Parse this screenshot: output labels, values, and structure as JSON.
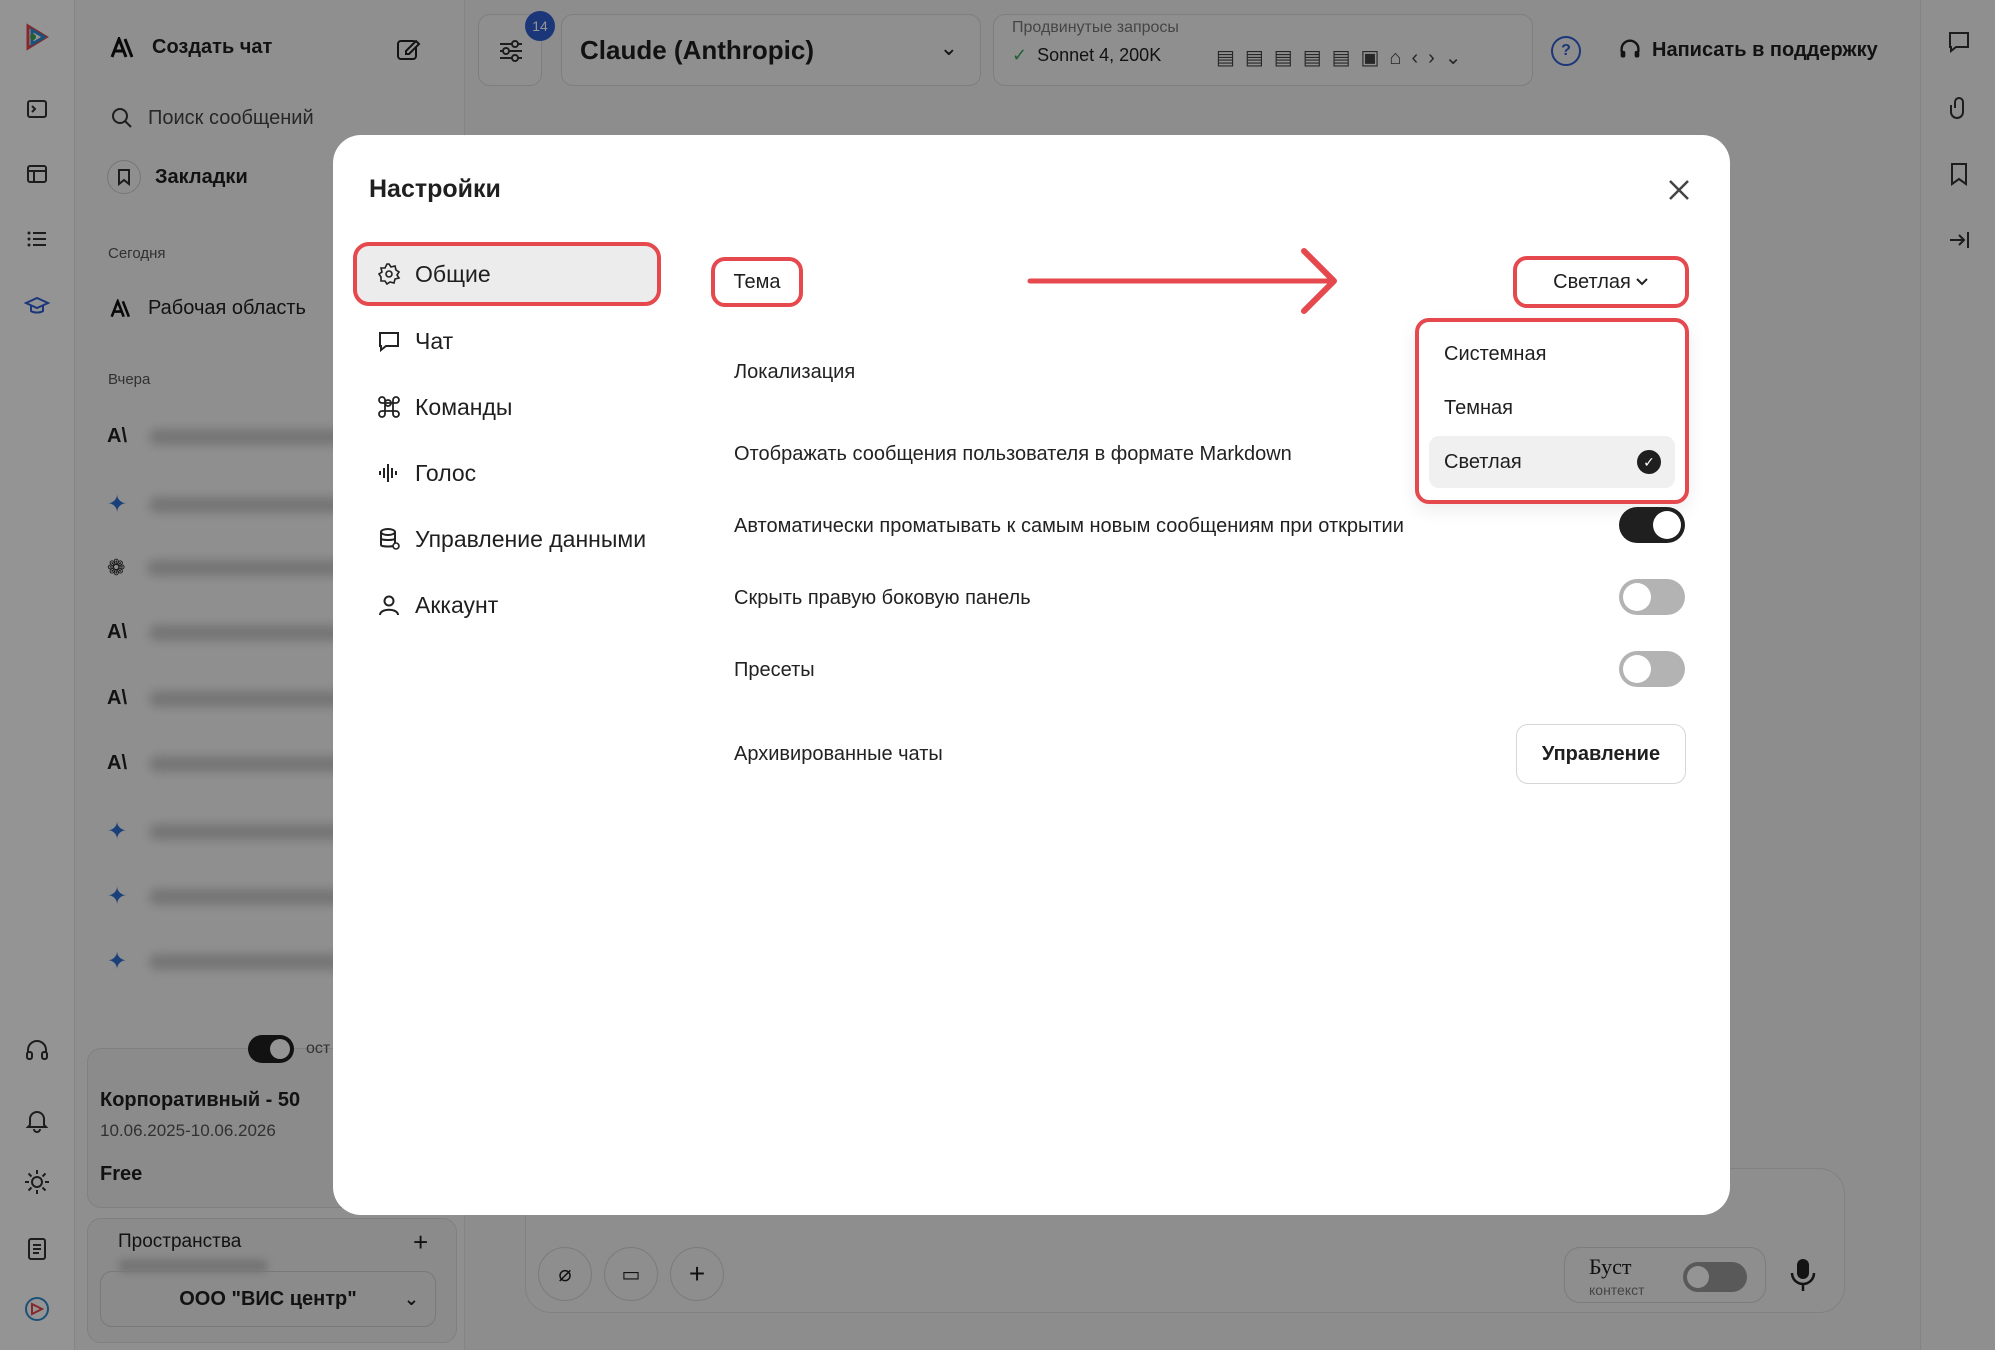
{
  "sidebar": {
    "create_chat": "Создать чат",
    "search_placeholder": "Поиск сообщений",
    "bookmarks": "Закладки",
    "section_today": "Сегодня",
    "workspace": "Рабочая область",
    "section_yesterday": "Вчера",
    "plan": {
      "toggle_text": "ост",
      "name": "Корпоративный - 50",
      "dates": "10.06.2025-10.06.2026",
      "tier": "Free"
    },
    "spaces": {
      "title": "Пространства",
      "org": "ООО \"ВИС центр\""
    }
  },
  "topbar": {
    "filter_badge": "14",
    "model": "Claude (Anthropic)",
    "advanced_label": "Продвинутые запросы",
    "advanced_value": "Sonnet 4, 200K",
    "support": "Написать в поддержку"
  },
  "composer": {
    "boost": "Буст",
    "context": "контекст"
  },
  "modal": {
    "title": "Настройки",
    "nav": [
      {
        "label": "Общие",
        "icon": "gear-icon"
      },
      {
        "label": "Чат",
        "icon": "chat-bubble-icon"
      },
      {
        "label": "Команды",
        "icon": "command-icon"
      },
      {
        "label": "Голос",
        "icon": "waveform-icon"
      },
      {
        "label": "Управление данными",
        "icon": "database-icon"
      },
      {
        "label": "Аккаунт",
        "icon": "user-icon"
      }
    ],
    "settings": {
      "theme_label": "Тема",
      "theme_value": "Светлая",
      "localization": "Локализация",
      "markdown": "Отображать сообщения пользователя в формате Markdown",
      "autoscroll": "Автоматически проматывать к самым новым сообщениям при открытии",
      "autoscroll_on": true,
      "hide_right_panel": "Скрыть правую боковую панель",
      "hide_right_panel_on": false,
      "presets": "Пресеты",
      "presets_on": false,
      "archived": "Архивированные чаты",
      "manage": "Управление"
    },
    "theme_options": [
      "Системная",
      "Темная",
      "Светлая"
    ],
    "theme_selected_index": 2
  },
  "colors": {
    "annotation_red": "#e5484d",
    "accent_blue": "#2f5fd0",
    "toggle_on": "#1f1f1f",
    "toggle_off": "#b3b3b3"
  }
}
